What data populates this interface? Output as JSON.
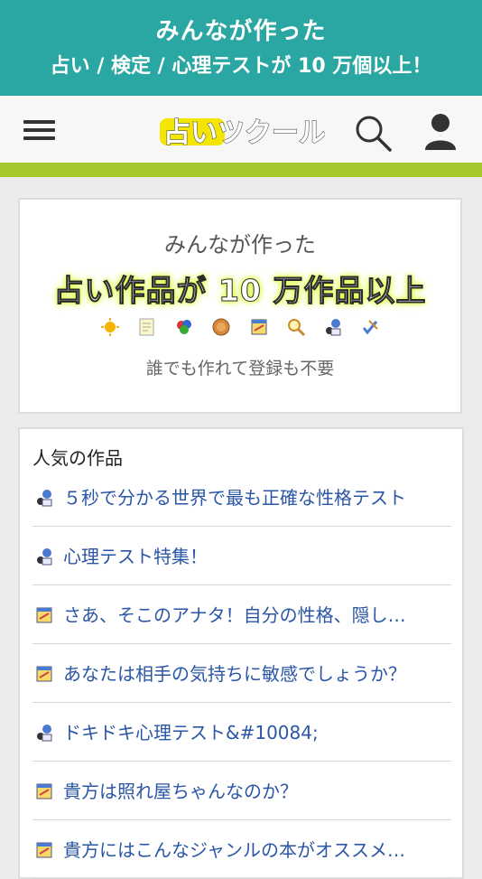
{
  "banner": {
    "line1": "みんなが作った",
    "line2": "占い / 検定 / 心理テストが 10 万個以上！"
  },
  "nav": {
    "logo_text": "占いツクール"
  },
  "hero": {
    "line1": "みんなが作った",
    "line2": "占い作品が 10 万作品以上",
    "line3": "誰でも作れて登録も不要",
    "icons": [
      "sun-icon",
      "memo-icon",
      "color-balls-icon",
      "shell-icon",
      "notebook-icon",
      "magnifier-icon",
      "fortune-teller-icon",
      "pen-check-icon"
    ]
  },
  "popular": {
    "heading": "人気の作品",
    "items": [
      {
        "title": "５秒で分かる世界で最も正確な性格テスト",
        "icon": "fortune-teller-icon"
      },
      {
        "title": "心理テスト特集！",
        "icon": "fortune-teller-icon"
      },
      {
        "title": "さあ、そこのアナタ！自分の性格、隠し…",
        "icon": "notebook-icon"
      },
      {
        "title": "あなたは相手の気持ちに敏感でしょうか？",
        "icon": "notebook-icon"
      },
      {
        "title": "ドキドキ心理テスト&#10084;",
        "icon": "fortune-teller-icon"
      },
      {
        "title": "貴方は照れ屋ちゃんなのか？",
        "icon": "notebook-icon"
      },
      {
        "title": "貴方にはこんなジャンルの本がオススメ…",
        "icon": "notebook-icon"
      }
    ]
  },
  "colors": {
    "banner": "#2aa7a2",
    "accent_bar": "#a5c82c",
    "link": "#2b56a6"
  }
}
